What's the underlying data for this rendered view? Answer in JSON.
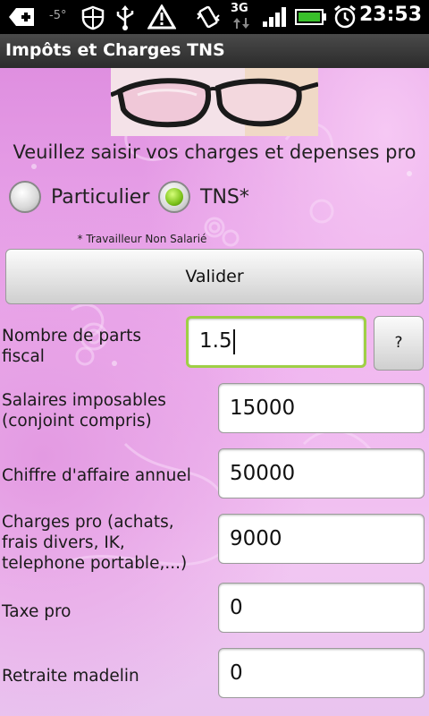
{
  "status_bar": {
    "temperature": "-5°",
    "network": "3G",
    "time": "23:53"
  },
  "title_bar": {
    "title": "Impôts et Charges TNS"
  },
  "form": {
    "prompt": "Veuillez saisir vos charges et depenses pro",
    "radio_particulier": "Particulier",
    "radio_tns": "TNS*",
    "footnote": "* Travailleur Non Salarié",
    "validate_label": "Valider",
    "help_label": "?",
    "fields": [
      {
        "label": "Nombre de parts fiscal",
        "value": "1.5"
      },
      {
        "label": "Salaires imposables (conjoint compris)",
        "value": "15000"
      },
      {
        "label": "Chiffre d'affaire annuel",
        "value": "50000"
      },
      {
        "label": "Charges pro (achats, frais divers, IK, telephone portable,...)",
        "value": "9000"
      },
      {
        "label": "Taxe pro",
        "value": "0"
      },
      {
        "label": "Retraite madelin",
        "value": "0"
      }
    ]
  },
  "colors": {
    "background": "#e9a6e9",
    "focus_border": "#9fcf46",
    "radio_selected": "#7cc21a"
  }
}
